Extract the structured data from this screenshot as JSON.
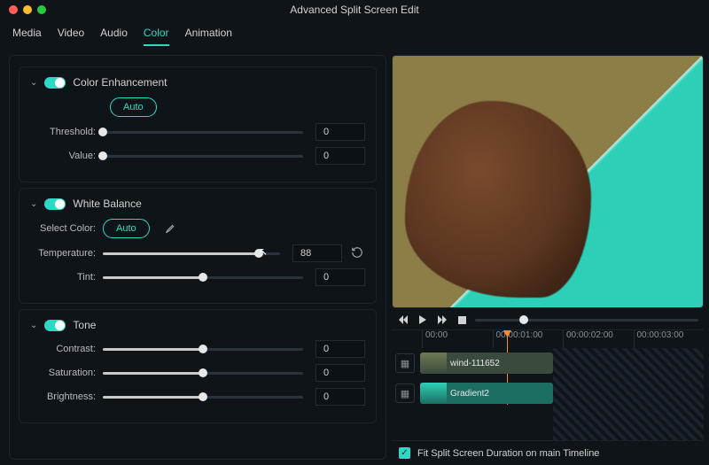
{
  "title": "Advanced Split Screen Edit",
  "tabs": [
    "Media",
    "Video",
    "Audio",
    "Color",
    "Animation"
  ],
  "activeTab": "Color",
  "color": {
    "enhance": {
      "title": "Color Enhancement",
      "auto": "Auto",
      "threshold": {
        "label": "Threshold:",
        "value": 0,
        "pct": 0
      },
      "value": {
        "label": "Value:",
        "value": 0,
        "pct": 0
      }
    },
    "wb": {
      "title": "White Balance",
      "select": "Select Color:",
      "auto": "Auto",
      "temperature": {
        "label": "Temperature:",
        "value": 88,
        "pct": 88
      },
      "tint": {
        "label": "Tint:",
        "value": 0,
        "pct": 50
      }
    },
    "tone": {
      "title": "Tone",
      "contrast": {
        "label": "Contrast:",
        "value": 0,
        "pct": 50
      },
      "saturation": {
        "label": "Saturation:",
        "value": 0,
        "pct": 50
      },
      "brightness": {
        "label": "Brightness:",
        "value": 0,
        "pct": 50
      }
    }
  },
  "timeline": {
    "ticks": [
      "00:00",
      "00:00:01:00",
      "00:00:02:00",
      "00:00:03:00"
    ],
    "clips": [
      {
        "name": "wind-111652"
      },
      {
        "name": "Gradient2"
      }
    ],
    "fit": "Fit Split Screen Duration on main Timeline"
  }
}
